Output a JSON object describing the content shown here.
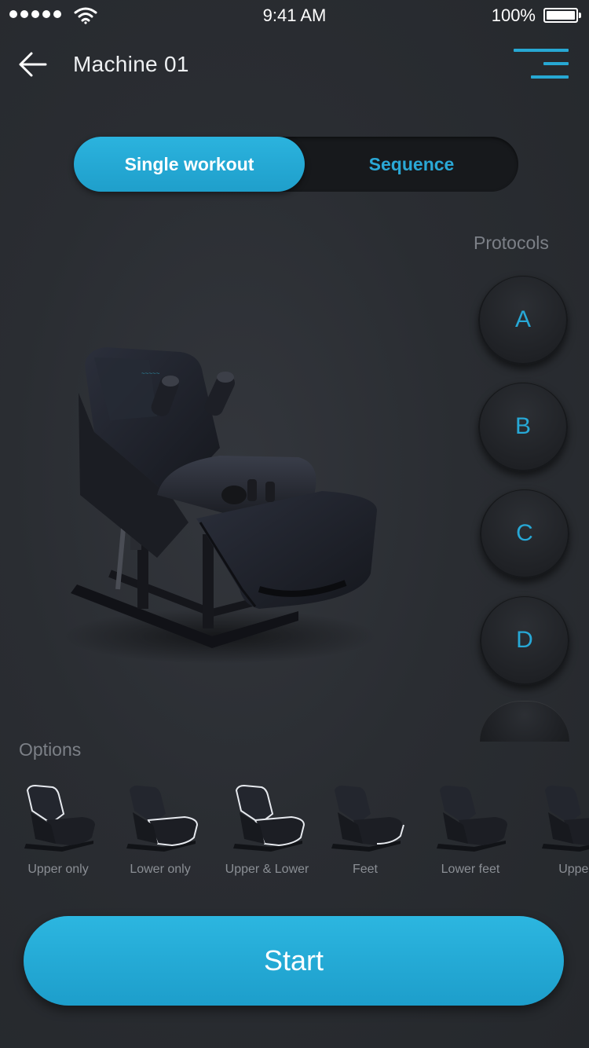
{
  "status_bar": {
    "time": "9:41 AM",
    "battery": "100%"
  },
  "header": {
    "title": "Machine 01",
    "back_icon": "arrow-left-icon",
    "menu_icon": "hamburger-menu-icon"
  },
  "mode_toggle": {
    "active": "Single workout",
    "inactive": "Sequence"
  },
  "protocols": {
    "label": "Protocols",
    "items": [
      "A",
      "B",
      "C",
      "D"
    ]
  },
  "options": {
    "label": "Options",
    "items": [
      "Upper only",
      "Lower only",
      "Upper & Lower",
      "Feet",
      "Lower feet",
      "Upper"
    ]
  },
  "start": {
    "label": "Start"
  },
  "colors": {
    "accent": "#27a8d6",
    "background": "#2a2d32",
    "muted_text": "#7c8087"
  }
}
